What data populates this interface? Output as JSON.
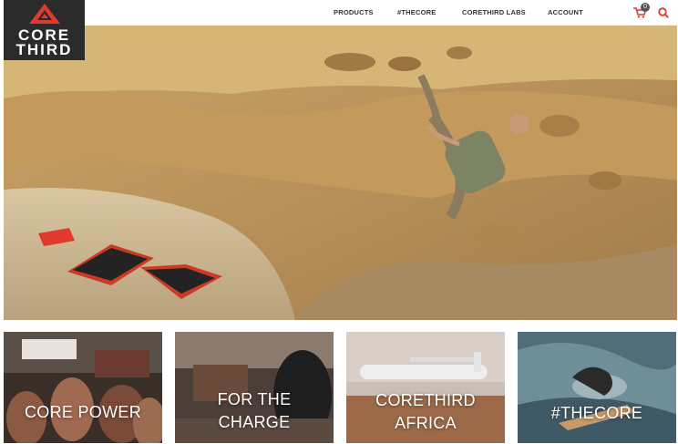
{
  "brand": {
    "logo_line1": "CORE",
    "logo_line2": "THIRD",
    "accent": "#e03a2e",
    "logo_bg": "#2b2b2b"
  },
  "nav": {
    "items": [
      "PRODUCTS",
      "#THECORE",
      "CORETHIRD LABS",
      "ACCOUNT"
    ],
    "cart_count": "0",
    "cart_icon": "cart-icon",
    "search_icon": "search-icon"
  },
  "hero": {
    "image": "rock-climber-with-solar-panel"
  },
  "tiles": [
    {
      "line1": "CORE POWER",
      "line2": ""
    },
    {
      "line1": "FOR THE",
      "line2": "CHARGE"
    },
    {
      "line1": "CORETHIRD",
      "line2": "AFRICA"
    },
    {
      "line1": "#THECORE",
      "line2": ""
    }
  ]
}
